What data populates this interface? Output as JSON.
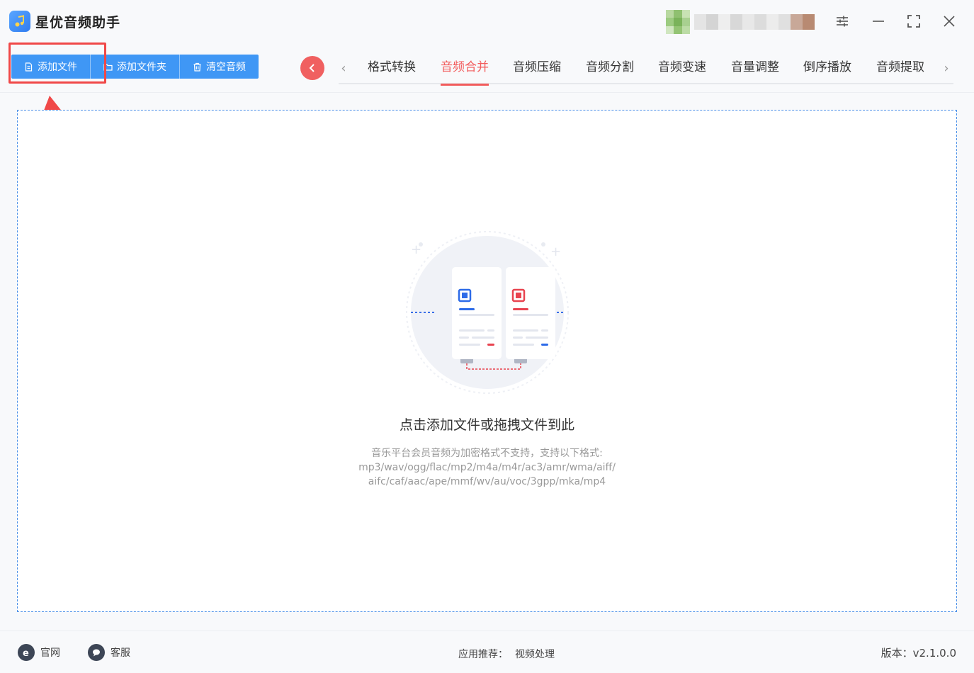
{
  "app": {
    "title": "星优音频助手",
    "accent_color": "#3f97f5",
    "active_color": "#f25c5c"
  },
  "toolbar": {
    "buttons": [
      {
        "label": "添加文件",
        "icon": "file-icon"
      },
      {
        "label": "添加文件夹",
        "icon": "folder-icon"
      },
      {
        "label": "清空音频",
        "icon": "trash-icon"
      }
    ]
  },
  "tabs": [
    {
      "label": "格式转换",
      "active": false
    },
    {
      "label": "音频合并",
      "active": true
    },
    {
      "label": "音频压缩",
      "active": false
    },
    {
      "label": "音频分割",
      "active": false
    },
    {
      "label": "音频变速",
      "active": false
    },
    {
      "label": "音量调整",
      "active": false
    },
    {
      "label": "倒序播放",
      "active": false
    },
    {
      "label": "音频提取",
      "active": false
    }
  ],
  "dropzone": {
    "title": "点击添加文件或拖拽文件到此",
    "hint_lines": [
      "音乐平台会员音频为加密格式不支持，支持以下格式:",
      "mp3/wav/ogg/flac/mp2/m4a/m4r/ac3/amr/wma/aiff/",
      "aifc/caf/aac/ape/mmf/wv/au/voc/3gpp/mka/mp4"
    ]
  },
  "footer": {
    "website_label": "官网",
    "support_label": "客服",
    "recommend_label": "应用推荐：",
    "recommend_link": "视频处理",
    "version_text": "版本：v2.1.0.0"
  }
}
